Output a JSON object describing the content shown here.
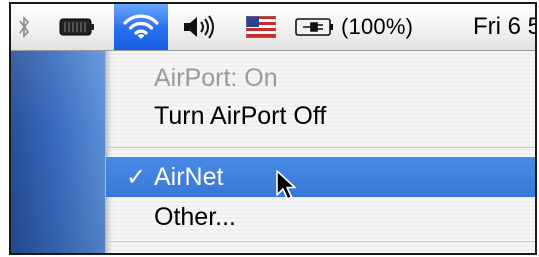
{
  "menubar": {
    "power_percent": "(100%)",
    "clock": "Fri 6 5"
  },
  "airport_menu": {
    "status": "AirPort: On",
    "turn_off": "Turn AirPort Off",
    "networks": [
      {
        "name": "AirNet",
        "selected": true,
        "check": "✓"
      }
    ],
    "other": "Other..."
  },
  "icons": {
    "bluetooth": "bluetooth-icon",
    "battery": "battery-icon",
    "airport": "wifi-icon",
    "volume": "volume-icon",
    "input_menu": "us-flag-icon",
    "power": "power-plug-icon",
    "cursor": "mouse-cursor-icon"
  },
  "colors": {
    "selection": "#3d80df",
    "airport_active": "#2c72f0",
    "disabled_text": "#9a9a9a",
    "desktop": "#3a6cc0"
  }
}
